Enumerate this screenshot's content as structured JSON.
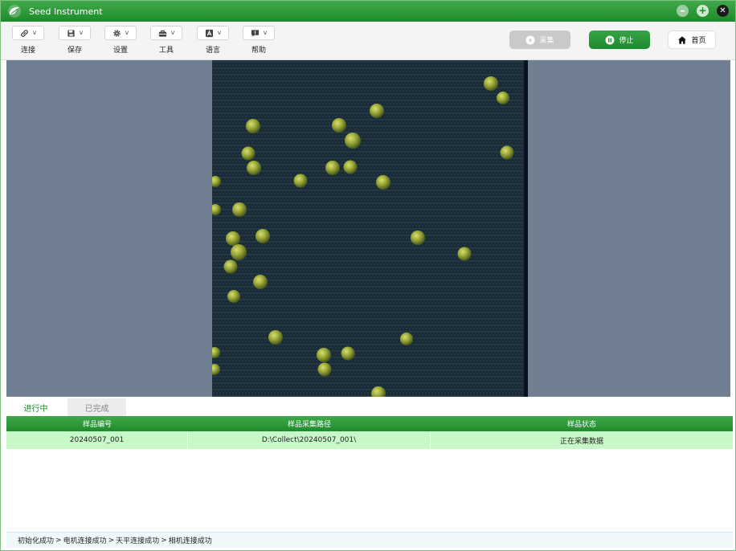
{
  "window": {
    "title": "Seed Instrument",
    "logo_icon": "app-leaf-logo",
    "controls": [
      "minimize-icon",
      "maximize-icon",
      "close-icon"
    ]
  },
  "toolbar": {
    "tools": [
      {
        "label": "连接",
        "icon": "link-icon"
      },
      {
        "label": "保存",
        "icon": "save-icon"
      },
      {
        "label": "设置",
        "icon": "gear-icon"
      },
      {
        "label": "工具",
        "icon": "toolbox-icon"
      },
      {
        "label": "语言",
        "icon": "language-icon"
      },
      {
        "label": "帮助",
        "icon": "help-icon"
      }
    ],
    "caret": "v",
    "collect_label": "采集",
    "stop_label": "停止",
    "home_label": "首页"
  },
  "tabs": {
    "active": "进行中",
    "inactive": "已完成"
  },
  "table": {
    "columns": [
      "样品编号",
      "样品采集路径",
      "样品状态"
    ],
    "rows": [
      {
        "id": "20240507_001",
        "path": "D:\\Collect\\20240507_001\\",
        "status": "正在采集数据"
      }
    ]
  },
  "status_bar": {
    "items": [
      "初始化成功",
      "电机连接成功",
      "天平连接成功",
      "相机连接成功"
    ],
    "separator": ">"
  },
  "colors": {
    "accent_green": "#1f8a2c",
    "row_highlight": "#c8f7c8",
    "viewer_background": "#707f91"
  }
}
